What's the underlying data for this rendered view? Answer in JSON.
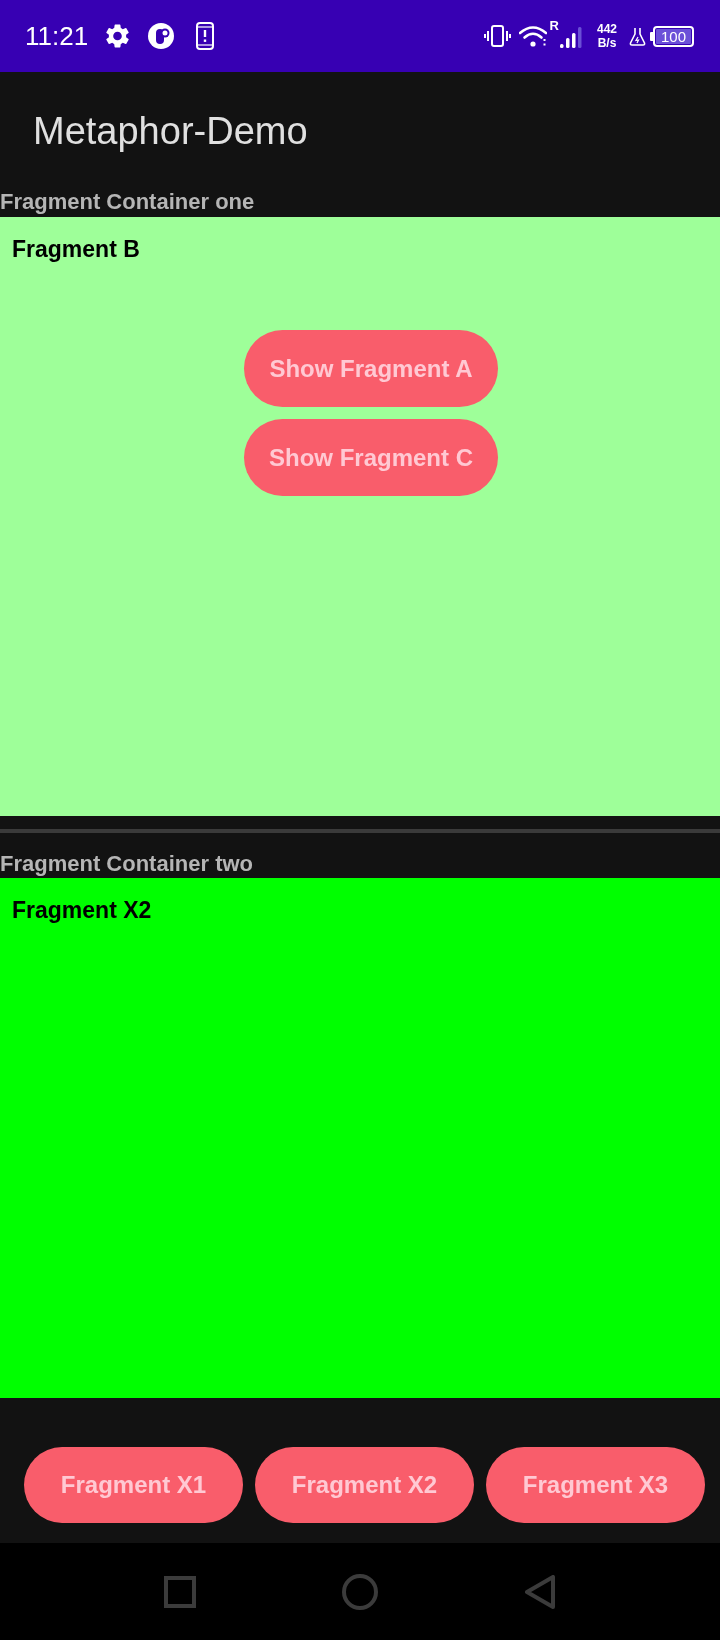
{
  "status_bar": {
    "time": "11:21",
    "signal_label": "R",
    "net_speed": "442",
    "net_speed_unit": "B/s",
    "battery": "100"
  },
  "app_bar": {
    "title": "Metaphor-Demo"
  },
  "containers": [
    {
      "label": "Fragment Container one",
      "fragment": {
        "title": "Fragment B",
        "color": "#9eff99",
        "buttons": [
          "Show Fragment A",
          "Show Fragment C"
        ]
      }
    },
    {
      "label": "Fragment Container two",
      "fragment": {
        "title": "Fragment X2",
        "color": "#00ff00"
      }
    }
  ],
  "bottom_buttons": [
    "Fragment X1",
    "Fragment X2",
    "Fragment X3"
  ]
}
